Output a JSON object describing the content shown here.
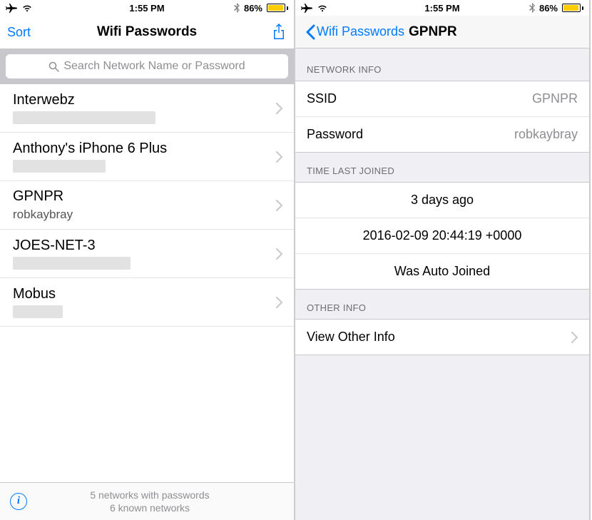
{
  "status": {
    "time": "1:55 PM",
    "battery_pct": "86%"
  },
  "left": {
    "nav": {
      "sort": "Sort",
      "title": "Wifi Passwords"
    },
    "search": {
      "placeholder": "Search Network Name or Password"
    },
    "rows": [
      {
        "ssid": "Interwebz",
        "pwd": "",
        "blur_w": "200"
      },
      {
        "ssid": "Anthony's iPhone 6 Plus",
        "pwd": "",
        "blur_w": "130"
      },
      {
        "ssid": "GPNPR",
        "pwd": "robkaybray",
        "blur_w": "0"
      },
      {
        "ssid": "JOES-NET-3",
        "pwd": "",
        "blur_w": "165"
      },
      {
        "ssid": "Mobus",
        "pwd": "",
        "blur_w": "70"
      }
    ],
    "footer": {
      "line1": "5 networks with passwords",
      "line2": "6 known networks"
    }
  },
  "right": {
    "back": "Wifi Passwords",
    "title": "GPNPR",
    "network_info_header": "NETWORK INFO",
    "ssid_label": "SSID",
    "ssid_value": "GPNPR",
    "pwd_label": "Password",
    "pwd_value": "robkaybray",
    "time_header": "TIME LAST JOINED",
    "relative": "3 days ago",
    "absolute": "2016-02-09 20:44:19 +0000",
    "auto": "Was Auto Joined",
    "other_header": "OTHER INFO",
    "other_row": "View Other Info"
  }
}
